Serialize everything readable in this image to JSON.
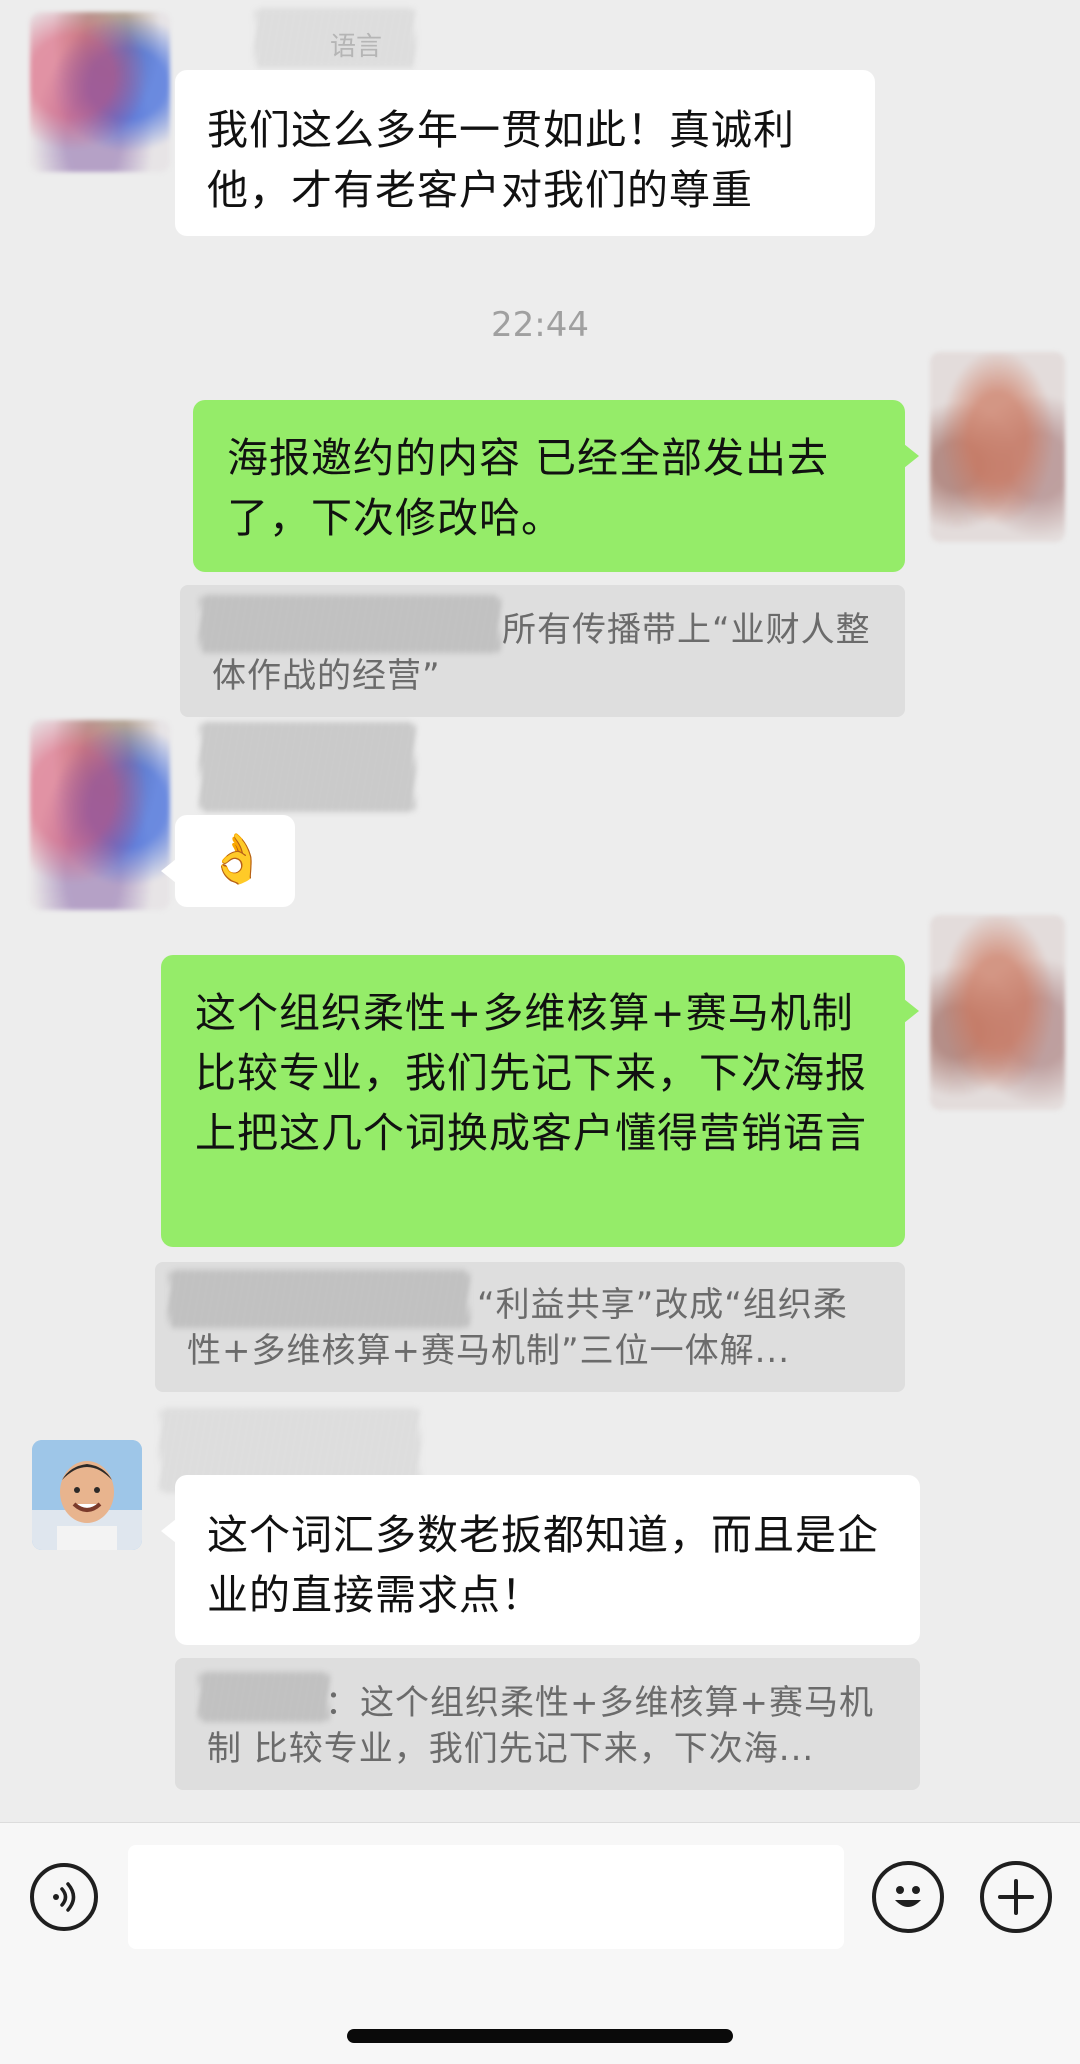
{
  "messages": {
    "msg1": {
      "sender_name_partial": "语言",
      "text": "我们这么多年一贯如此！真诚利他，才有老客户对我们的尊重"
    },
    "time_divider": "22:44",
    "msg2": {
      "text": "海报邀约的内容 已经全部发出去了，下次修改哈。",
      "quote": "所有传播带上“业财人整体作战的经营”"
    },
    "msg3": {
      "emoji": "👌"
    },
    "msg4": {
      "text": "这个组织柔性+多维核算+赛马机制 比较专业，我们先记下来，下次海报上把这几个词换成客户懂得营销语言",
      "quote": "“利益共享”改成“组织柔性+多维核算+赛马机制”三位一体解..."
    },
    "msg5": {
      "text": "这个词汇多数老扳都知道，而且是企业的直接需求点！",
      "quote": "：这个组织柔性+多维核算+赛马机制 比较专业，我们先记下来，下次海..."
    }
  },
  "input_bar": {
    "message_value": "",
    "voice_icon": "voice-icon",
    "emoji_icon": "emoji-icon",
    "add_icon": "plus-icon"
  },
  "colors": {
    "background": "#ededed",
    "green_bubble": "#95ec69",
    "white_bubble": "#ffffff",
    "quote_bg": "#dedede"
  }
}
